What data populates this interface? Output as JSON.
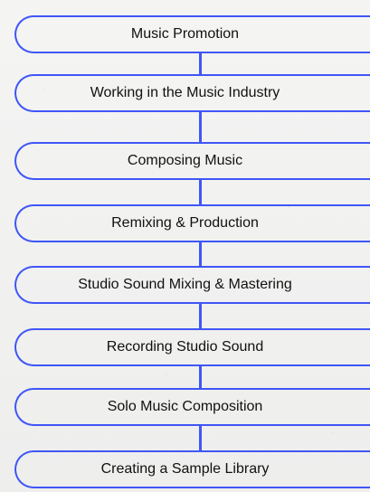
{
  "flowchart": {
    "steps": [
      "Music Promotion",
      "Working in the Music Industry",
      "Composing Music",
      "Remixing & Production",
      "Studio Sound Mixing & Mastering",
      "Recording Studio Sound",
      "Solo Music Composition",
      "Creating a Sample Library"
    ]
  },
  "colors": {
    "accent": "#3f56f6",
    "background": "#f1f1f0",
    "text": "#111111"
  }
}
